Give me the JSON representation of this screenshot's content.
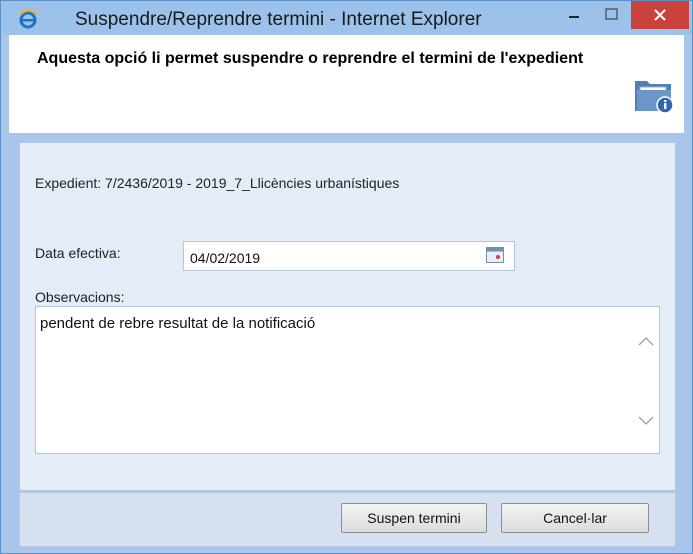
{
  "window": {
    "title": "Suspendre/Reprendre termini - Internet Explorer",
    "accent_color": "#9cc1ea",
    "close_color": "#c8413a"
  },
  "header": {
    "description": "Aquesta opció li permet suspendre o reprendre el termini de l'expedient",
    "icon": "folder-info-icon"
  },
  "form": {
    "expedient_text": "Expedient: 7/2436/2019 - 2019_7_Llicències urbanístiques",
    "date_label": "Data efectiva:",
    "date_value": "04/02/2019",
    "observations_label": "Observacions:",
    "observations_value": "pendent de rebre resultat de la notificació"
  },
  "footer": {
    "suspend_label": "Suspen termini",
    "cancel_label": "Cancel·lar"
  }
}
